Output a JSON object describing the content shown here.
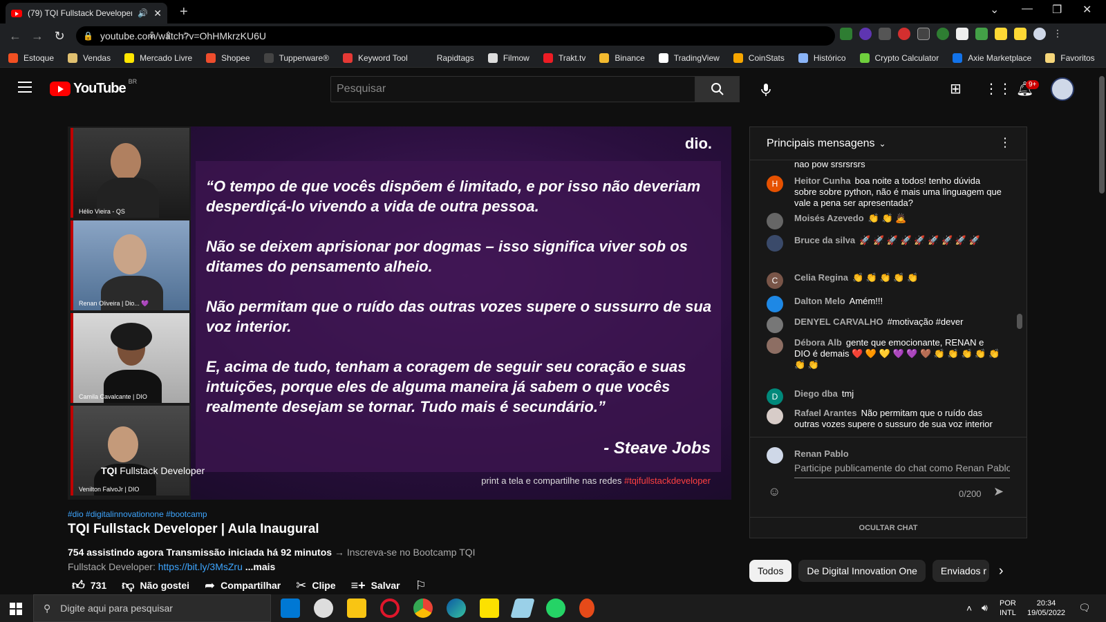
{
  "browser": {
    "tab_title": "(79) TQI Fullstack Developer",
    "url": "youtube.com/watch?v=OhHMkrzKU6U",
    "bookmarks": [
      {
        "label": "Estoque",
        "color": "#f25022"
      },
      {
        "label": "Vendas",
        "color": "#e0c070"
      },
      {
        "label": "Mercado Livre",
        "color": "#ffe600"
      },
      {
        "label": "Shopee",
        "color": "#ee4d2d"
      },
      {
        "label": "Tupperware®",
        "color": "#444444"
      },
      {
        "label": "Keyword Tool",
        "color": "#e53935"
      },
      {
        "label": "Rapidtags",
        "color": "#1f2124"
      },
      {
        "label": "Filmow",
        "color": "#dddddd"
      },
      {
        "label": "Trakt.tv",
        "color": "#ed1c24"
      },
      {
        "label": "Binance",
        "color": "#f3ba2f"
      },
      {
        "label": "TradingView",
        "color": "#ffffff"
      },
      {
        "label": "CoinStats",
        "color": "#f7a600"
      },
      {
        "label": "Histórico",
        "color": "#8ab4f8"
      },
      {
        "label": "Crypto Calculator",
        "color": "#6fcf3d"
      },
      {
        "label": "Axie Marketplace",
        "color": "#1273ea"
      },
      {
        "label": "Favoritos",
        "color": "#f5d67a"
      }
    ]
  },
  "youtube": {
    "logo_text": "YouTube",
    "country": "BR",
    "search_placeholder": "Pesquisar",
    "notifications": "9+"
  },
  "video": {
    "quote": [
      "“O tempo de que vocês dispõem é limitado, e por isso não deveriam desperdiçá-lo vivendo a vida de outra pessoa.",
      "Não se deixem aprisionar por dogmas – isso significa viver sob os ditames do pensamento alheio.",
      "Não permitam que o ruído das outras vozes supere o sussurro de sua voz interior.",
      "E, acima de tudo, tenham a coragem de seguir seu coração e suas intuições, porque eles de alguma maneira já sabem o que vocês realmente desejam se tornar. Tudo mais é secundário.”"
    ],
    "author": "-   Steave Jobs",
    "brand": "dio.",
    "print_text": "print a tela e compartilhe nas redes ",
    "print_hashtag": "#tqifullstackdeveloper",
    "tqi_bold": "TQI",
    "tqi_rest": " Fullstack Developer",
    "cams": [
      {
        "label": "Hélio Vieira - QS"
      },
      {
        "label": "Renan Oliveira | Dio... 💜"
      },
      {
        "label": "Camila Cavalcante | DIO"
      },
      {
        "label": "Venilton FalvoJr | DIO"
      }
    ]
  },
  "info": {
    "tags": "#dio #digitalinnovationone #bootcamp",
    "title": "TQI Fullstack Developer | Aula Inaugural",
    "stats": "754 assistindo agora  Transmissão iniciada há 92 minutos",
    "desc": " → Inscreva-se no Bootcamp TQI Fullstack Developer: ",
    "link": "https://bit.ly/3MsZru",
    "more": " ...mais",
    "likes": "731",
    "dislike": "Não gostei",
    "share": "Compartilhar",
    "clip": "Clipe",
    "save": "Salvar"
  },
  "chat": {
    "header": "Principais mensagens",
    "partial_top": "nao pow srsrsrsrs",
    "messages": [
      {
        "author": "Heitor Cunha",
        "text": "boa noite a todos! tenho dúvida sobre sobre python, não é mais uma linguagem que vale a pena ser apresentada?",
        "initial": "H",
        "color": "#e65100"
      },
      {
        "author": "Moisés Azevedo",
        "text": "👏 👏 🙇",
        "initial": "",
        "color": "#666666"
      },
      {
        "author": "Bruce da silva",
        "text": "🚀 🚀 🚀 🚀 🚀 🚀 🚀 🚀 🚀",
        "initial": "",
        "color": "#3a4a6a"
      },
      {
        "author": "Celia Regina",
        "text": "👏 👏 👏 👏 👏",
        "initial": "C",
        "color": "#795548"
      },
      {
        "author": "Dalton Melo",
        "text": "Amém!!!",
        "initial": "",
        "color": "#1e88e5"
      },
      {
        "author": "DENYEL CARVALHO",
        "text": "#motivação #dever",
        "initial": "",
        "color": "#777777"
      },
      {
        "author": "Débora Alb",
        "text": "gente que emocionante, RENAN e DIO é demais ❤️ 🧡 💛 💜 💜 🤎 👏 👏 👏 👏 👏 👏 👏",
        "initial": "",
        "color": "#8d6e63"
      },
      {
        "author": "Diego dba",
        "text": "tmj",
        "initial": "D",
        "color": "#00897b"
      },
      {
        "author": "Rafael Arantes",
        "text": "Não permitam que o ruído das outras vozes supere o sussuro de sua voz interior",
        "initial": "",
        "color": "#d7ccc8"
      }
    ],
    "user": "Renan Pablo",
    "placeholder": "Participe publicamente do chat como Renan Pablo...",
    "counter": "0/200",
    "hide": "OCULTAR CHAT"
  },
  "chips": [
    "Todos",
    "De Digital Innovation One",
    "Enviados r"
  ],
  "taskbar": {
    "search": "Digite aqui para pesquisar",
    "lang1": "POR",
    "lang2": "INTL",
    "time": "20:34",
    "date": "19/05/2022"
  }
}
